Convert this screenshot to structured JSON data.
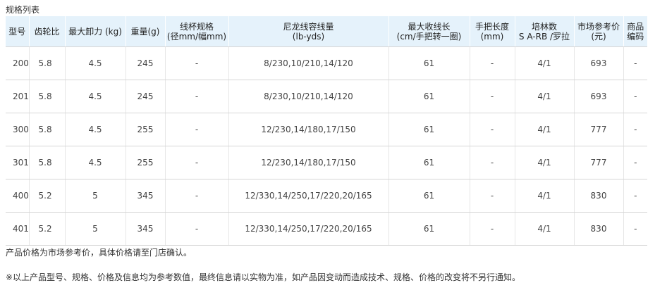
{
  "title": "规格列表",
  "columns": [
    "型号",
    "齿轮比",
    "最大卸力 (kg)",
    "重量(g)",
    "线杯规格\n(径mm/幅mm)",
    "尼龙线容线量\n(lb-yds)",
    "最大收线长\n(cm/手把转一圈)",
    "手把长度\n(mm)",
    "培林数\nS A-RB /罗拉",
    "市场参考价\n(元)",
    "商品编码"
  ],
  "rows": [
    [
      "200",
      "5.8",
      "4.5",
      "245",
      "-",
      "8/230,10/210,14/120",
      "61",
      "-",
      "4/1",
      "693",
      "-"
    ],
    [
      "201",
      "5.8",
      "4.5",
      "245",
      "-",
      "8/230,10/210,14/120",
      "61",
      "-",
      "4/1",
      "693",
      "-"
    ],
    [
      "300",
      "5.8",
      "4.5",
      "255",
      "-",
      "12/230,14/180,17/150",
      "61",
      "-",
      "4/1",
      "777",
      "-"
    ],
    [
      "301",
      "5.8",
      "4.5",
      "255",
      "-",
      "12/230,14/180,17/150",
      "61",
      "-",
      "4/1",
      "777",
      "-"
    ],
    [
      "400",
      "5.2",
      "5",
      "345",
      "-",
      "12/330,14/250,17/220,20/165",
      "61",
      "-",
      "4/1",
      "830",
      "-"
    ],
    [
      "401",
      "5.2",
      "5",
      "345",
      "-",
      "12/330,14/250,17/220,20/165",
      "61",
      "-",
      "4/1",
      "830",
      "-"
    ]
  ],
  "notes": {
    "price_note": "产品价格为市场参考价，具体价格请至门店确认。",
    "disclaimer": "※以上产品型号、规格、价格及信息均为参考数值，最终信息请以实物为准，如产品因变动而造成技术、规格、价格的改变将不另行通知。"
  },
  "colors": {
    "header_bg": "#e5f2fb",
    "border": "#d6d6d6"
  }
}
